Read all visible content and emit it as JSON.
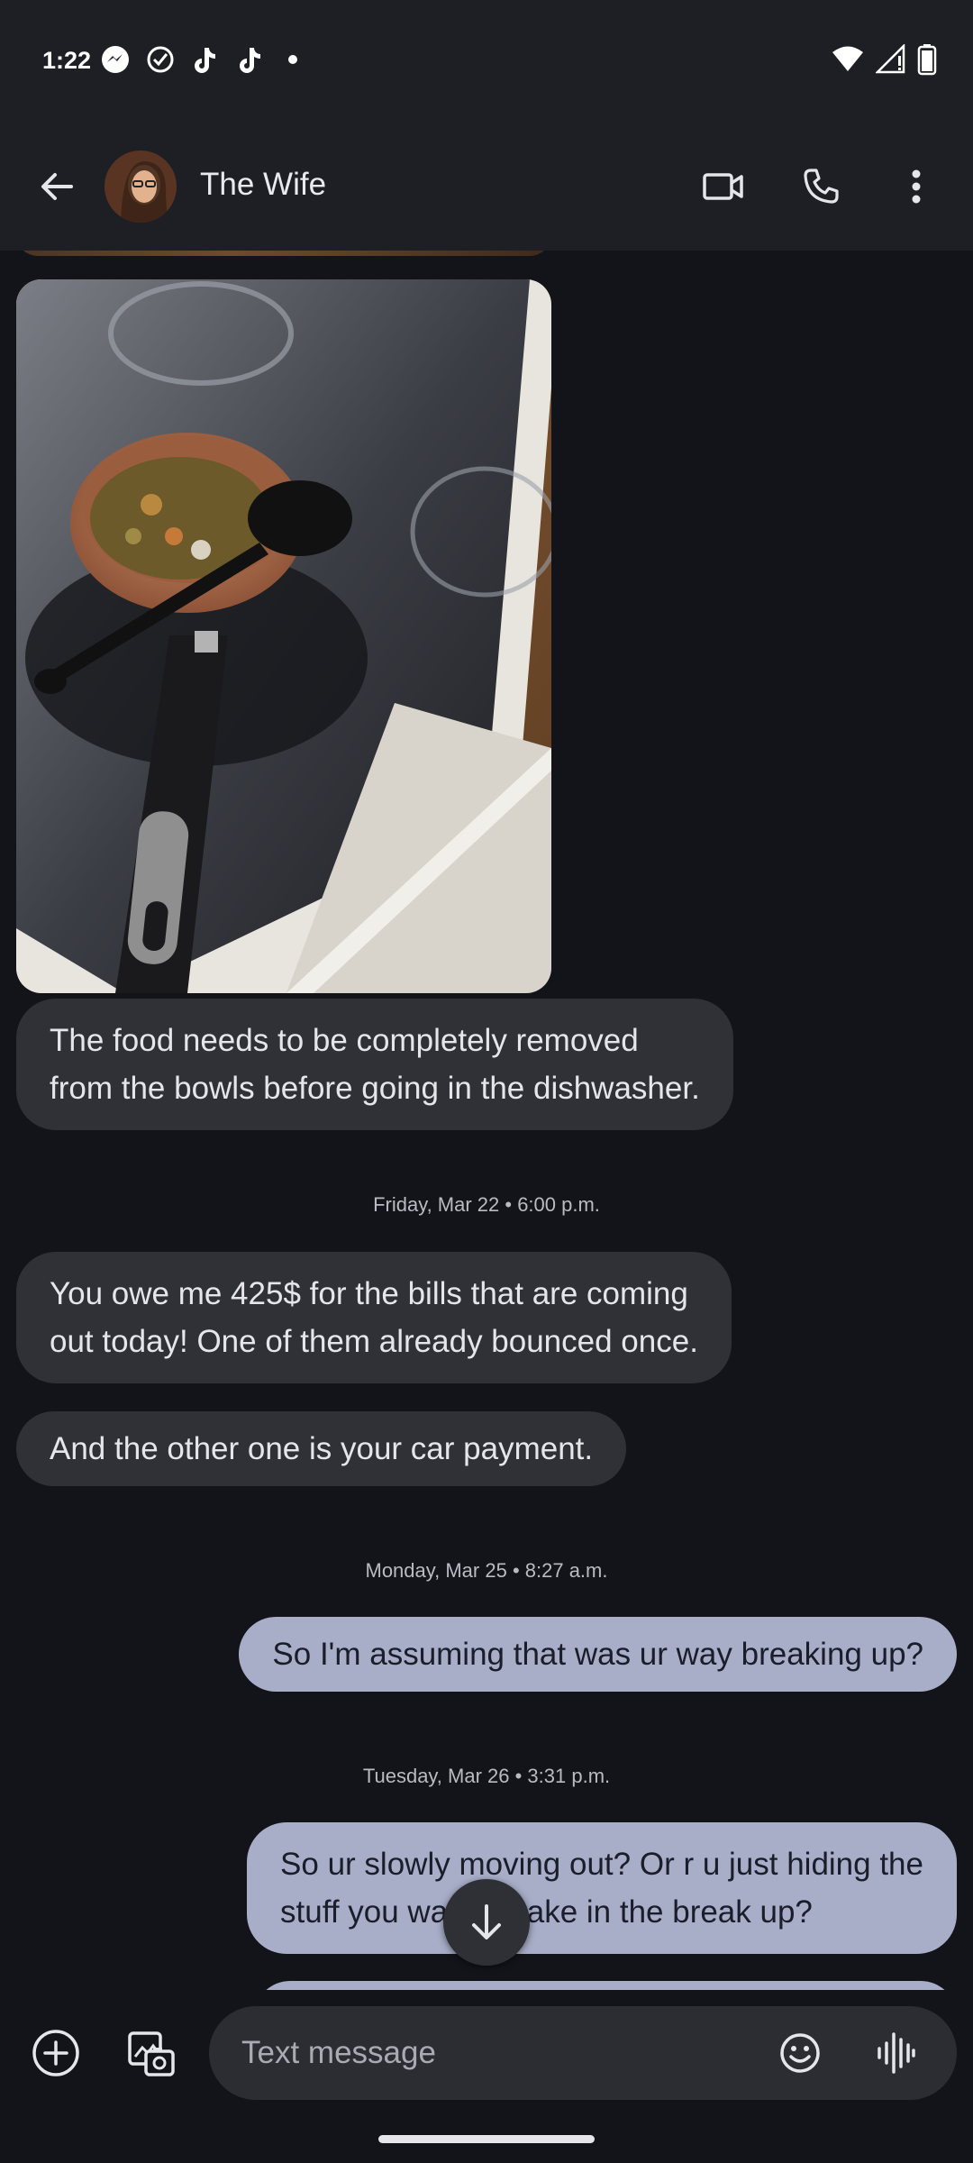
{
  "status_bar": {
    "time": "1:22",
    "left_icons": [
      "messenger-icon",
      "task-check-icon",
      "tiktok-icon",
      "tiktok-icon",
      "notification-dot"
    ],
    "right_icons": [
      "wifi-icon",
      "signal-icon",
      "battery-icon"
    ]
  },
  "header": {
    "contact_name": "The Wife",
    "actions": [
      "video-call",
      "phone-call",
      "more-options"
    ]
  },
  "messages": [
    {
      "type": "image",
      "direction": "incoming",
      "description_icon": "photo"
    },
    {
      "type": "text",
      "direction": "incoming",
      "lines": [
        "The food needs to be completely removed",
        "from the bowls before going in the dishwasher."
      ]
    },
    {
      "type": "timestamp",
      "text": "Friday, Mar 22 • 6:00 p.m."
    },
    {
      "type": "text",
      "direction": "incoming",
      "lines": [
        "You owe me 425$ for the bills that are coming",
        "out today! One of them already bounced once."
      ]
    },
    {
      "type": "text",
      "direction": "incoming",
      "lines": [
        "And the other one is your car payment."
      ]
    },
    {
      "type": "timestamp",
      "text": "Monday, Mar 25 • 8:27 a.m."
    },
    {
      "type": "text",
      "direction": "outgoing",
      "lines": [
        "So I'm assuming that was ur way breaking up?"
      ]
    },
    {
      "type": "timestamp",
      "text": "Tuesday, Mar 26 • 3:31 p.m."
    },
    {
      "type": "text",
      "direction": "outgoing",
      "lines": [
        "So ur slowly moving out? Or r u just hiding the",
        "stuff you want to take in the break up?"
      ]
    }
  ],
  "composer": {
    "placeholder": "Text message"
  },
  "colors": {
    "background": "#131419",
    "bar": "#1e1f25",
    "incoming_bubble": "#303136",
    "outgoing_bubble": "#a8aec8"
  }
}
